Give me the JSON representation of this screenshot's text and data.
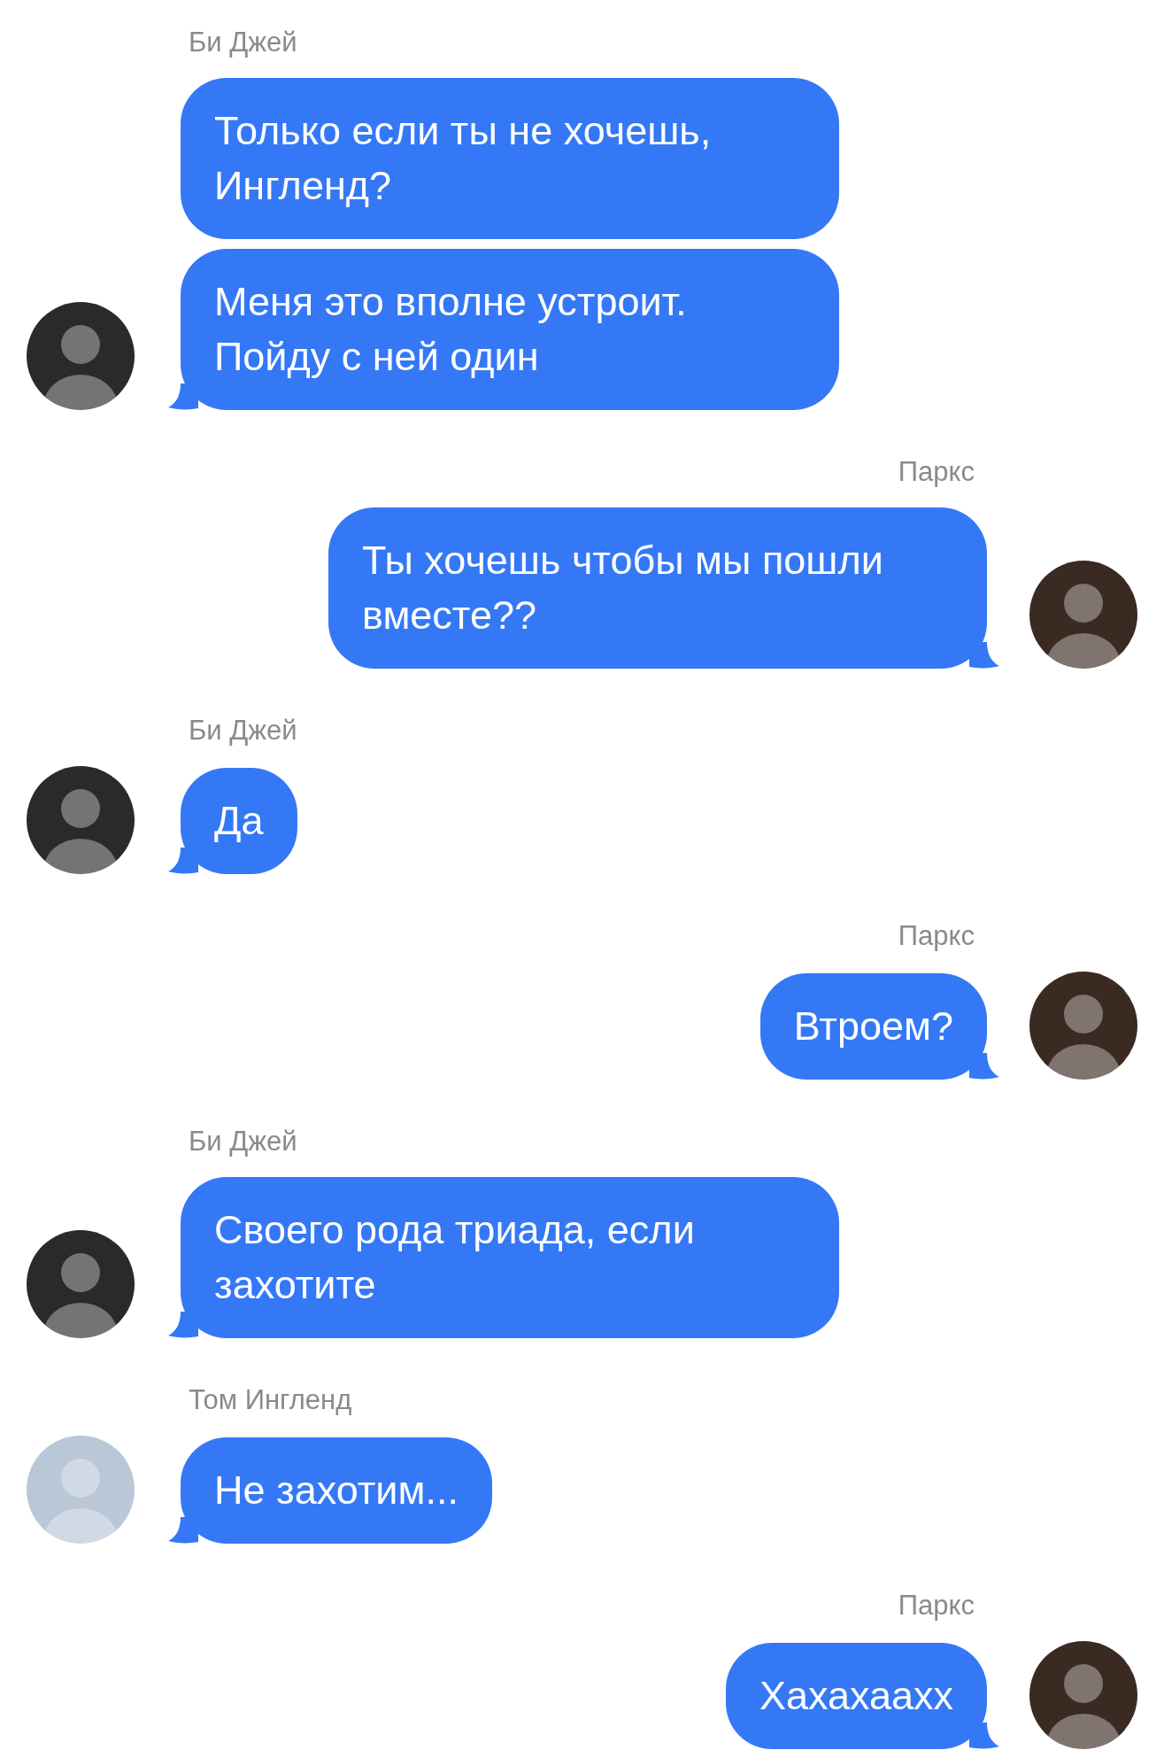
{
  "messages": [
    {
      "sender": "Би Джей",
      "kind": "incoming",
      "color": "#2a2a2a",
      "bubbles": [
        "Только если ты не хочешь, Ингленд?",
        "Меня это вполне устроит. Пойду с ней один"
      ]
    },
    {
      "sender": "Паркс",
      "kind": "outgoing",
      "color": "#3b2a22",
      "bubbles": [
        "Ты хочешь чтобы мы пошли вместе??"
      ]
    },
    {
      "sender": "Би Джей",
      "kind": "incoming",
      "color": "#2a2a2a",
      "bubbles": [
        "Да"
      ]
    },
    {
      "sender": "Паркс",
      "kind": "outgoing",
      "color": "#3b2a22",
      "bubbles": [
        "Втроем?"
      ]
    },
    {
      "sender": "Би Джей",
      "kind": "incoming",
      "color": "#2a2a2a",
      "bubbles": [
        "Своего рода триада, если захотите"
      ]
    },
    {
      "sender": "Том Ингленд",
      "kind": "incoming",
      "color": "#b9c7d6",
      "bubbles": [
        "Не захотим..."
      ]
    },
    {
      "sender": "Паркс",
      "kind": "outgoing",
      "color": "#3b2a22",
      "bubbles": [
        "Хахахаахх"
      ]
    }
  ]
}
